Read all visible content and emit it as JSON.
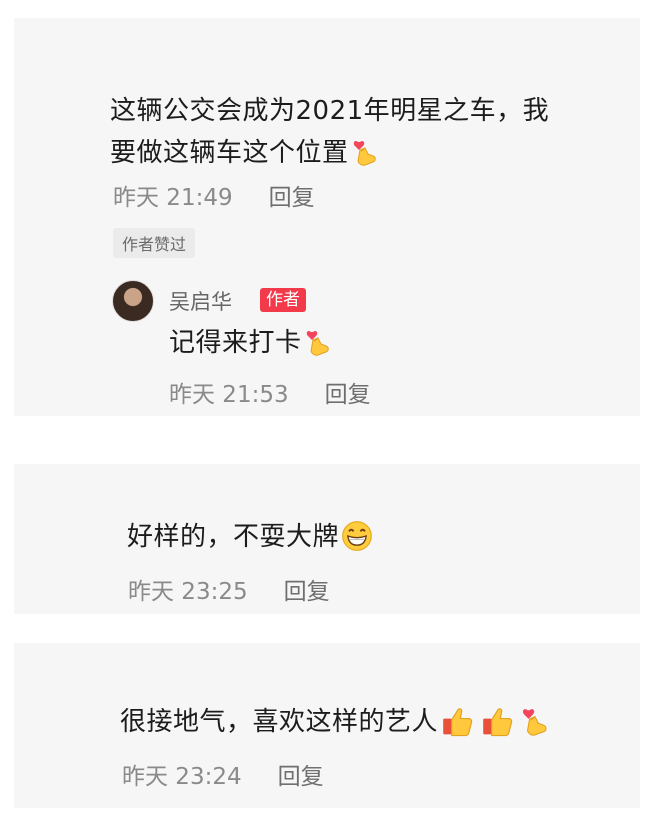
{
  "comments": [
    {
      "text_line1": "这辆公交会成为2021年明星之车，我",
      "text_line2": "要做这辆车这个位置",
      "time": "昨天 21:49",
      "reply": "回复",
      "liked_badge": "作者赞过",
      "emojis": [
        "finger-heart-icon"
      ],
      "author_reply": {
        "username": "吴启华",
        "tag": "作者",
        "text": "记得来打卡",
        "time": "昨天 21:53",
        "reply": "回复",
        "emojis": [
          "finger-heart-icon"
        ]
      }
    },
    {
      "text": "好样的，不耍大牌",
      "time": "昨天 23:25",
      "reply": "回复",
      "emojis": [
        "grinning-face-icon"
      ]
    },
    {
      "text": "很接地气，喜欢这样的艺人",
      "time": "昨天 23:24",
      "reply": "回复",
      "emojis": [
        "thumbs-up-icon",
        "thumbs-up-icon",
        "finger-heart-icon"
      ]
    }
  ],
  "colors": {
    "card_bg": "#f6f6f7",
    "author_tag": "#f23a4a",
    "text": "#1c1c1c",
    "meta": "#8a8a8a"
  }
}
